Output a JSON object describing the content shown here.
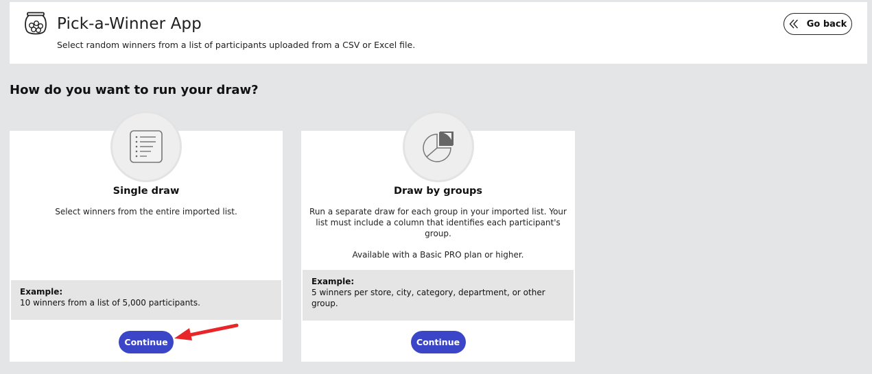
{
  "header": {
    "app_icon": "fishbowl-icon",
    "title": "Pick-a-Winner App",
    "subtitle": "Select random winners from a list of participants uploaded from a CSV or Excel file.",
    "go_back_label": "Go back",
    "go_back_icon": "double-chevron-left-icon"
  },
  "question": "How do you want to run your draw?",
  "options": [
    {
      "icon": "list-icon",
      "title": "Single draw",
      "description": "Select winners from the entire imported list.",
      "example_label": "Example:",
      "example_text": "10 winners from a list of 5,000 participants.",
      "button_label": "Continue"
    },
    {
      "icon": "pie-chart-icon",
      "title": "Draw by groups",
      "description": "Run a separate draw for each group in your imported list. Your list must include a column that identifies each participant's group.",
      "note": "Available with a Basic PRO plan or higher.",
      "example_label": "Example:",
      "example_text": "5 winners per store, city, category, department, or other group.",
      "button_label": "Continue"
    }
  ],
  "colors": {
    "background": "#e4e5e7",
    "primary_button": "#3b45c8",
    "annotation_arrow": "#e8262a"
  }
}
